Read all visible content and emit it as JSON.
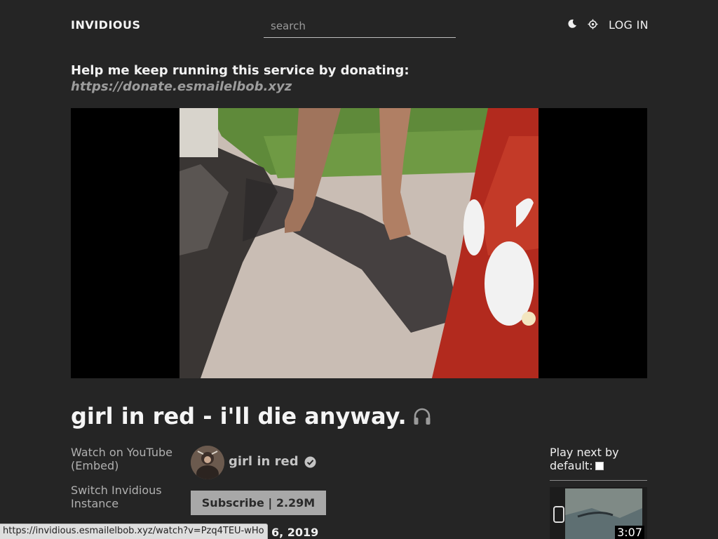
{
  "header": {
    "brand": "INVIDIOUS",
    "search_placeholder": "search",
    "login_label": "LOG IN",
    "icons": [
      "moon-icon",
      "gear-icon"
    ]
  },
  "banner": {
    "text": "Help me keep running this service by donating:",
    "link": "https://donate.esmailelbob.xyz"
  },
  "video": {
    "title": "girl in red - i'll die anyway.",
    "audio_icon": "headphones-icon",
    "watch_on_prefix": "Watch on YouTube",
    "embed_label": "Embed",
    "switch_instance": "Switch Invidious Instance",
    "channel_name": "girl in red",
    "subscribe_label": "Subscribe | 2.29M",
    "published_fragment": "6, 2019"
  },
  "sidebar": {
    "play_next_label": "Play next by default:",
    "autoplay_checked": false,
    "next_video_duration": "3:07"
  },
  "statusbar": {
    "url": "https://invidious.esmailelbob.xyz/watch?v=Pzq4TEU-wHo"
  },
  "colors": {
    "background": "#252525",
    "text": "#f0f0f0",
    "muted": "#b0b0b0",
    "subscribe_bg": "#a8a8a8"
  }
}
